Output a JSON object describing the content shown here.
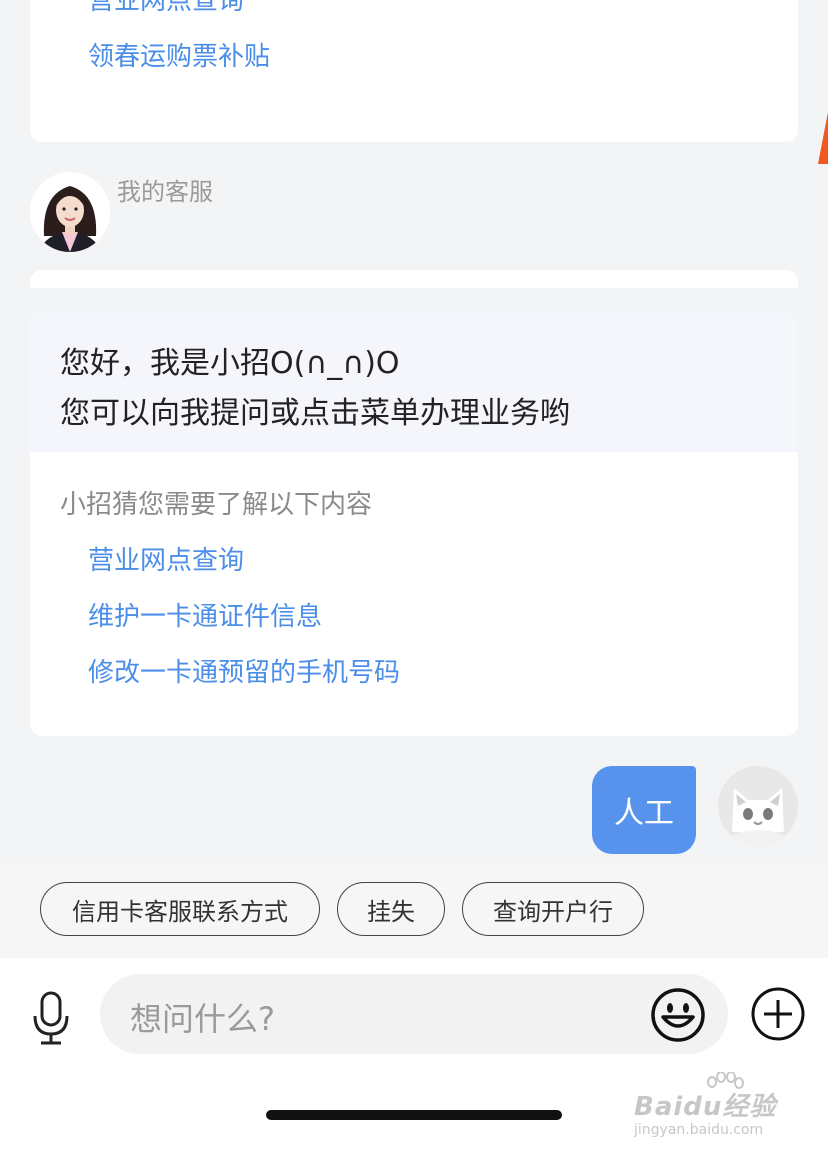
{
  "top_card": {
    "links": [
      "营业网点查询",
      "领春运购票补贴"
    ]
  },
  "agent_message": {
    "sender": "我的客服",
    "greeting_line1": "您好，我是小招O(∩_∩)O",
    "greeting_line2": "您可以向我提问或点击菜单办理业务哟",
    "guess_title": "小招猜您需要了解以下内容",
    "suggestions": [
      "营业网点查询",
      "维护一卡通证件信息",
      "修改一卡通预留的手机号码"
    ]
  },
  "user_message": {
    "text": "人工"
  },
  "quick_replies": [
    "信用卡客服联系方式",
    "挂失",
    "查询开户行"
  ],
  "input_bar": {
    "placeholder": "想问什么?",
    "icons": [
      "microphone-icon",
      "emoji-icon",
      "plus-icon"
    ]
  },
  "watermark": {
    "brand": "Baidu经验",
    "url": "jingyan.baidu.com"
  },
  "colors": {
    "link": "#4b8ee9",
    "user_bubble": "#5793ec",
    "background": "#f3f4f6",
    "accent_mark": "#f05a22"
  }
}
